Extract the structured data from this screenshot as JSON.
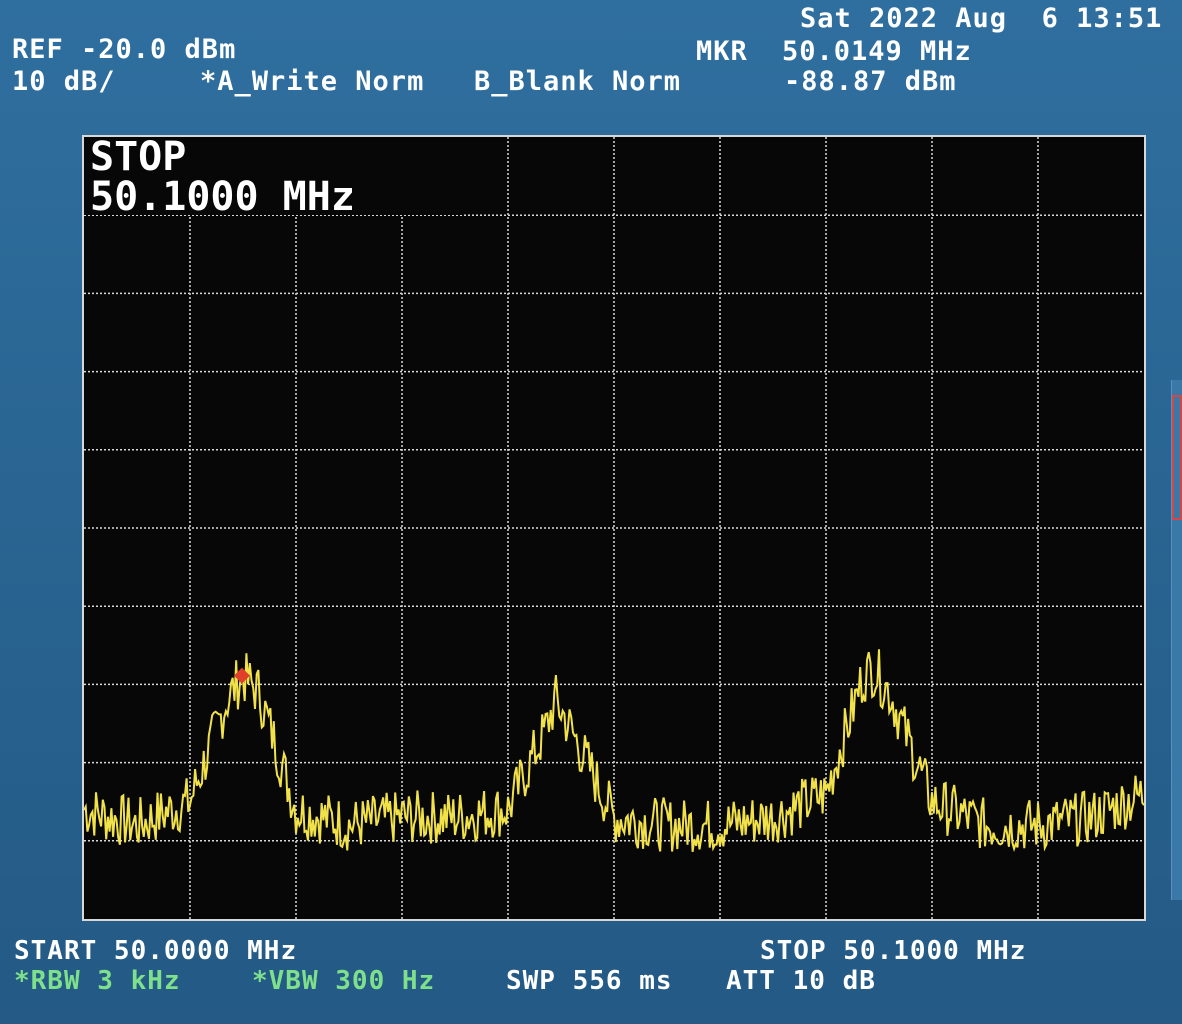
{
  "header": {
    "datetime": "Sat 2022 Aug  6 13:51",
    "ref": "REF -20.0 dBm",
    "scale": "10 dB/",
    "trace_a": "*A_Write Norm",
    "trace_b": "B_Blank Norm",
    "marker_label": "MKR",
    "marker_freq": "50.0149 MHz",
    "marker_level": "-88.87 dBm"
  },
  "screen": {
    "annotation_line1": "STOP",
    "annotation_line2": "50.1000 MHz"
  },
  "footer": {
    "start": "START 50.0000 MHz",
    "stop": "STOP 50.1000 MHz",
    "rbw": "*RBW 3 kHz",
    "vbw": "*VBW 300 Hz",
    "sweep": "SWP 556 ms",
    "attenuation": "ATT 10 dB"
  },
  "colors": {
    "trace": "#f2e24a",
    "marker": "#e0402a",
    "grid": "#d8d8d8",
    "screen_bg": "#070707",
    "bezel": "#2a6593"
  },
  "chart_data": {
    "type": "line",
    "title": "",
    "xlabel": "",
    "ylabel": "",
    "xlim": [
      50.0,
      50.1
    ],
    "ylim": [
      -120,
      -20
    ],
    "x_unit": "MHz",
    "y_unit": "dBm",
    "grid": true,
    "series": [
      {
        "values_x": [
          50.0,
          50.005,
          50.01,
          50.0135,
          50.0149,
          50.0165,
          50.02,
          50.025,
          50.03,
          50.035,
          50.04,
          50.0435,
          50.0445,
          50.046,
          50.05,
          50.055,
          50.06,
          50.065,
          50.07,
          50.0735,
          50.0745,
          50.076,
          50.08,
          50.085,
          50.09,
          50.095,
          50.1
        ],
        "values_y": [
          -106,
          -108,
          -105,
          -92,
          -88.9,
          -91,
          -106,
          -108,
          -107,
          -107,
          -106,
          -96,
          -92,
          -96,
          -107,
          -108,
          -108,
          -107,
          -104,
          -89,
          -88,
          -91,
          -105,
          -108,
          -108,
          -107,
          -104
        ]
      }
    ],
    "markers": [
      {
        "x": 50.0149,
        "y": -88.87
      }
    ]
  }
}
